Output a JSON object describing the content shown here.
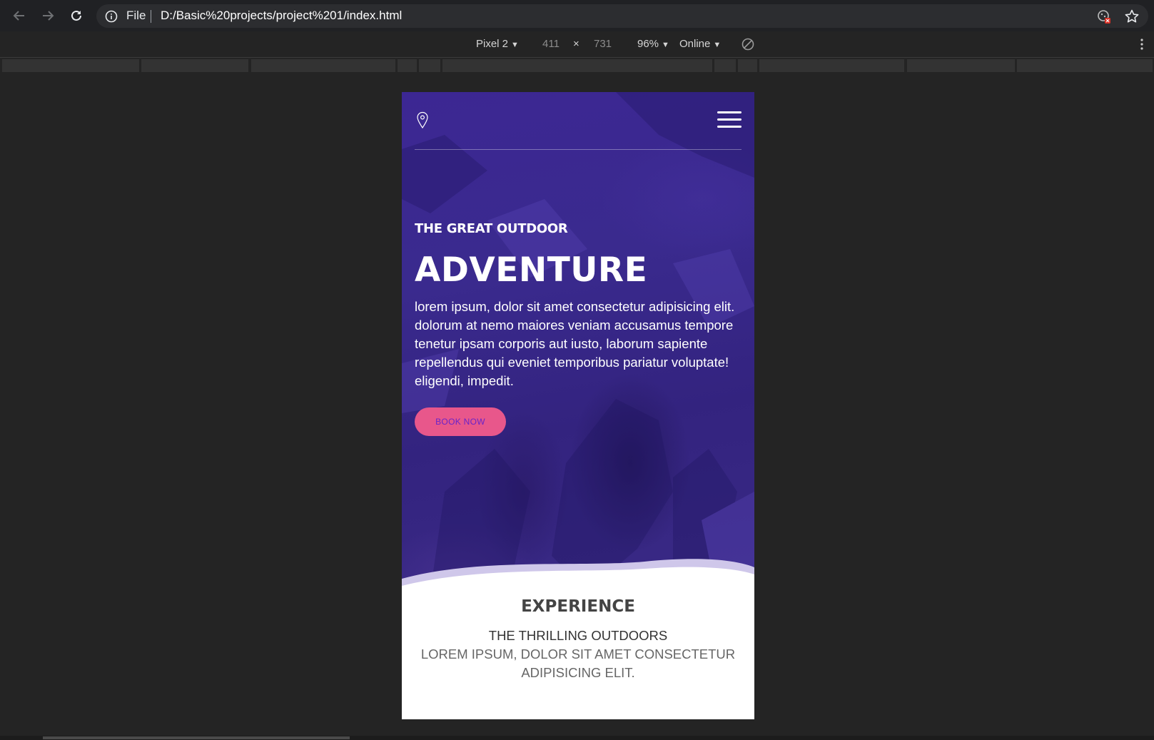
{
  "browser": {
    "back_icon": "arrow-left-icon",
    "forward_icon": "arrow-right-icon",
    "reload_icon": "reload-icon",
    "scheme_label": "File",
    "url": "D:/Basic%20projects/project%201/index.html",
    "extension_icon": "cookie-blocked-icon",
    "bookmark_icon": "star-icon"
  },
  "device_toolbar": {
    "device": "Pixel 2",
    "width": "411",
    "times": "×",
    "height": "731",
    "zoom": "96%",
    "network": "Online",
    "caret": "▼",
    "rotate_icon": "rotate-icon",
    "more_icon": "more-vertical-icon"
  },
  "page": {
    "location_icon": "map-pin-icon",
    "menu_icon": "hamburger-menu-icon",
    "subtitle": "THE GREAT OUTDOOR",
    "headline": "ADVENTURE",
    "lede": "lorem ipsum, dolor sit amet consectetur adipisicing elit. dolorum at nemo maiores veniam accusamus tempore tenetur ipsam corporis aut iusto, laborum sapiente repellendus qui eveniet temporibus pariatur voluptate! eligendi, impedit.",
    "cta": "BOOK NOW",
    "section_title": "EXPERIENCE",
    "section_subtitle": "THE THRILLING OUTDOORS",
    "section_text": "LOREM IPSUM, DOLOR SIT AMET CONSECTETUR ADIPISICING ELIT."
  },
  "colors": {
    "hero_purple": "#3a2a8e",
    "button_pink": "#e8578b",
    "button_text": "#6a24c8",
    "browser_bg": "#202124"
  }
}
